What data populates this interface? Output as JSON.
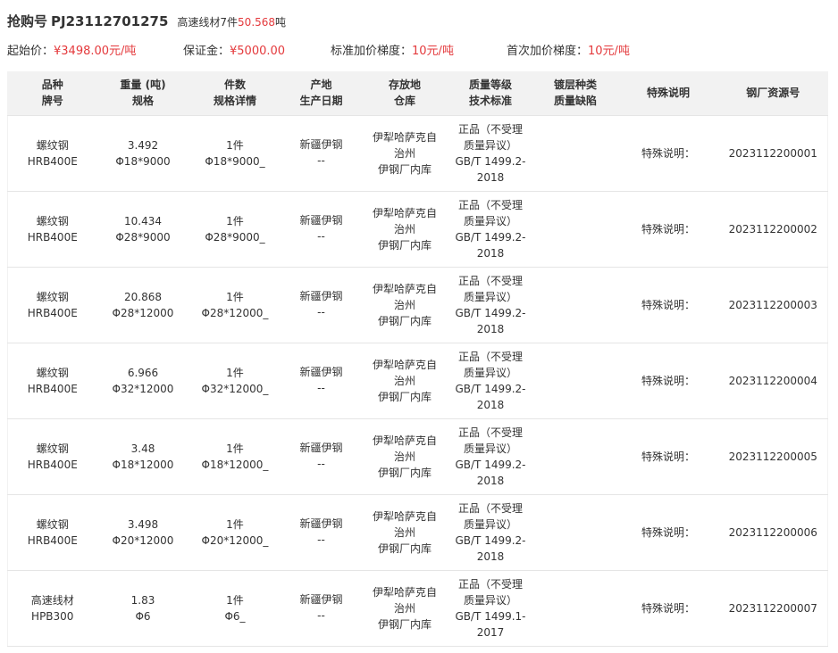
{
  "header": {
    "order_label": "抢购号",
    "order_no": "PJ23112701275",
    "summary_prefix": "高速线材7件",
    "summary_weight": "50.568",
    "summary_unit": "吨"
  },
  "info": {
    "start_price_label": "起始价：",
    "start_price_value": "¥3498.00元/吨",
    "deposit_label": "保证金：",
    "deposit_value": "¥5000.00",
    "std_step_label": "标准加价梯度：",
    "std_step_value": "10元/吨",
    "first_step_label": "首次加价梯度：",
    "first_step_value": "10元/吨"
  },
  "table": {
    "headers": [
      {
        "l1": "品种",
        "l2": "牌号"
      },
      {
        "l1": "重量 (吨)",
        "l2": "规格"
      },
      {
        "l1": "件数",
        "l2": "规格详情"
      },
      {
        "l1": "产地",
        "l2": "生产日期"
      },
      {
        "l1": "存放地",
        "l2": "仓库"
      },
      {
        "l1": "质量等级",
        "l2": "技术标准"
      },
      {
        "l1": "镀层种类",
        "l2": "质量缺陷"
      },
      {
        "l1": "特殊说明",
        "l2": ""
      },
      {
        "l1": "钢厂资源号",
        "l2": ""
      }
    ],
    "rows": [
      {
        "variety": "螺纹钢",
        "grade": "HRB400E",
        "weight": "3.492",
        "spec": "Φ18*9000",
        "pieces": "1件",
        "spec_detail": "Φ18*9000_",
        "origin": "新疆伊钢",
        "prod_date": "--",
        "wh1": "伊犁哈萨克自",
        "wh2": "治州",
        "wh3": "伊钢厂内库",
        "q1": "正品（不受理",
        "q2": "质量异议）",
        "q3": "GB/T 1499.2-",
        "q4": "2018",
        "coating": "",
        "defect": "",
        "special": "特殊说明：",
        "resource": "2023112200001"
      },
      {
        "variety": "螺纹钢",
        "grade": "HRB400E",
        "weight": "10.434",
        "spec": "Φ28*9000",
        "pieces": "1件",
        "spec_detail": "Φ28*9000_",
        "origin": "新疆伊钢",
        "prod_date": "--",
        "wh1": "伊犁哈萨克自",
        "wh2": "治州",
        "wh3": "伊钢厂内库",
        "q1": "正品（不受理",
        "q2": "质量异议）",
        "q3": "GB/T 1499.2-",
        "q4": "2018",
        "coating": "",
        "defect": "",
        "special": "特殊说明：",
        "resource": "2023112200002"
      },
      {
        "variety": "螺纹钢",
        "grade": "HRB400E",
        "weight": "20.868",
        "spec": "Φ28*12000",
        "pieces": "1件",
        "spec_detail": "Φ28*12000_",
        "origin": "新疆伊钢",
        "prod_date": "--",
        "wh1": "伊犁哈萨克自",
        "wh2": "治州",
        "wh3": "伊钢厂内库",
        "q1": "正品（不受理",
        "q2": "质量异议）",
        "q3": "GB/T 1499.2-",
        "q4": "2018",
        "coating": "",
        "defect": "",
        "special": "特殊说明：",
        "resource": "2023112200003"
      },
      {
        "variety": "螺纹钢",
        "grade": "HRB400E",
        "weight": "6.966",
        "spec": "Φ32*12000",
        "pieces": "1件",
        "spec_detail": "Φ32*12000_",
        "origin": "新疆伊钢",
        "prod_date": "--",
        "wh1": "伊犁哈萨克自",
        "wh2": "治州",
        "wh3": "伊钢厂内库",
        "q1": "正品（不受理",
        "q2": "质量异议）",
        "q3": "GB/T 1499.2-",
        "q4": "2018",
        "coating": "",
        "defect": "",
        "special": "特殊说明：",
        "resource": "2023112200004"
      },
      {
        "variety": "螺纹钢",
        "grade": "HRB400E",
        "weight": "3.48",
        "spec": "Φ18*12000",
        "pieces": "1件",
        "spec_detail": "Φ18*12000_",
        "origin": "新疆伊钢",
        "prod_date": "--",
        "wh1": "伊犁哈萨克自",
        "wh2": "治州",
        "wh3": "伊钢厂内库",
        "q1": "正品（不受理",
        "q2": "质量异议）",
        "q3": "GB/T 1499.2-",
        "q4": "2018",
        "coating": "",
        "defect": "",
        "special": "特殊说明：",
        "resource": "2023112200005"
      },
      {
        "variety": "螺纹钢",
        "grade": "HRB400E",
        "weight": "3.498",
        "spec": "Φ20*12000",
        "pieces": "1件",
        "spec_detail": "Φ20*12000_",
        "origin": "新疆伊钢",
        "prod_date": "--",
        "wh1": "伊犁哈萨克自",
        "wh2": "治州",
        "wh3": "伊钢厂内库",
        "q1": "正品（不受理",
        "q2": "质量异议）",
        "q3": "GB/T 1499.2-",
        "q4": "2018",
        "coating": "",
        "defect": "",
        "special": "特殊说明：",
        "resource": "2023112200006"
      },
      {
        "variety": "高速线材",
        "grade": "HPB300",
        "weight": "1.83",
        "spec": "Φ6",
        "pieces": "1件",
        "spec_detail": "Φ6_",
        "origin": "新疆伊钢",
        "prod_date": "--",
        "wh1": "伊犁哈萨克自",
        "wh2": "治州",
        "wh3": "伊钢厂内库",
        "q1": "正品（不受理",
        "q2": "质量异议）",
        "q3": "GB/T 1499.1-",
        "q4": "2017",
        "coating": "",
        "defect": "",
        "special": "特殊说明：",
        "resource": "2023112200007"
      }
    ]
  }
}
